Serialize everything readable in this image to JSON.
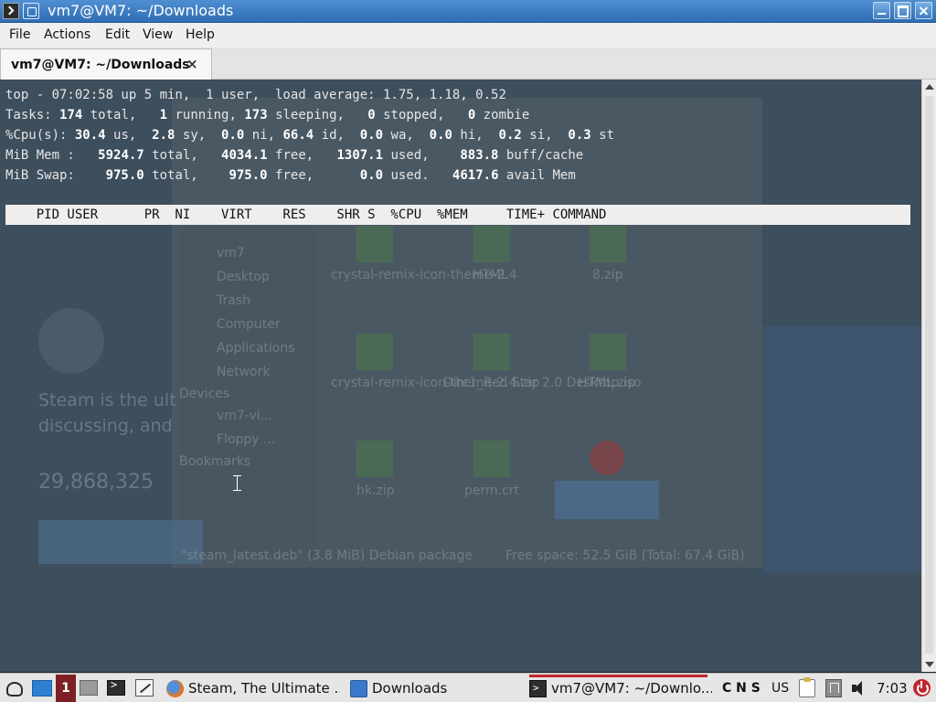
{
  "window": {
    "title": "vm7@VM7: ~/Downloads",
    "controls": [
      "minimize",
      "maximize",
      "close"
    ]
  },
  "menubar": {
    "items": [
      "File",
      "Actions",
      "Edit",
      "View",
      "Help"
    ]
  },
  "tabs": [
    {
      "label": "vm7@VM7: ~/Downloads",
      "active": true,
      "close_glyph": "×"
    }
  ],
  "terminal": {
    "top_summary": {
      "line1": "top - 07:02:58 up 5 min,  1 user,  load average: 1.75, 1.18, 0.52",
      "tasks": {
        "label": "Tasks:",
        "total": "174",
        "running": "1",
        "sleeping": "173",
        "stopped": "0",
        "zombie": "0"
      },
      "cpu": {
        "label": "%Cpu(s):",
        "us": "30.4",
        "sy": "2.8",
        "ni": "0.0",
        "id": "66.4",
        "wa": "0.0",
        "hi": "0.0",
        "si": "0.2",
        "st": "0.3"
      },
      "mem": {
        "label": "MiB Mem :",
        "total": "5924.7",
        "free": "4034.1",
        "used": "1307.1",
        "buff_cache": "883.8"
      },
      "swap": {
        "label": "MiB Swap:",
        "total": "975.0",
        "free": "975.0",
        "used": "0.0",
        "avail_mem": "4617.6"
      }
    },
    "process_header": "    PID USER      PR  NI    VIRT    RES    SHR S  %CPU  %MEM     TIME+ COMMAND",
    "background_ghost": {
      "steam_tagline_1": "Steam is the ult",
      "steam_tagline_2": "discussing, and",
      "steam_count": "29,868,325",
      "fm_sidebar": [
        "vm7",
        "Desktop",
        "Trash",
        "Computer",
        "Applications",
        "Network",
        "Devices",
        "vm7-vi...",
        "Floppy ...",
        "Bookmarks"
      ],
      "fm_files": [
        "crystal-remix-icon-theme-2.4",
        "HTML",
        "8.zip",
        "crystal-remix-icon-theme-2.4.zip",
        "Dirc1_Red Star 2.0 Desktop.iso",
        "HTML.zip",
        "hk.zip",
        "perm.crt"
      ],
      "fm_status": "\"steam_latest.deb\" (3.8 MiB) Debian package",
      "fm_free": "Free space: 52.5 GiB (Total: 67.4 GiB)"
    }
  },
  "taskbar": {
    "workspace": "1",
    "tasks": [
      {
        "label": "Steam, The Ultimate ...",
        "icon": "firefox-icon"
      },
      {
        "label": "Downloads",
        "icon": "folder-icon"
      },
      {
        "label": "vm7@VM7: ~/Downlo...",
        "icon": "terminal-icon",
        "active": true
      }
    ],
    "tray": {
      "indicators": "C N S",
      "keyboard_layout": "US",
      "clock": "7:03"
    }
  },
  "colors": {
    "titlebar": "#3a7bc4",
    "terminal_bg": "#3d4e5c",
    "taskbar_active": "#c0262d",
    "workspace": "#7d1f24"
  }
}
